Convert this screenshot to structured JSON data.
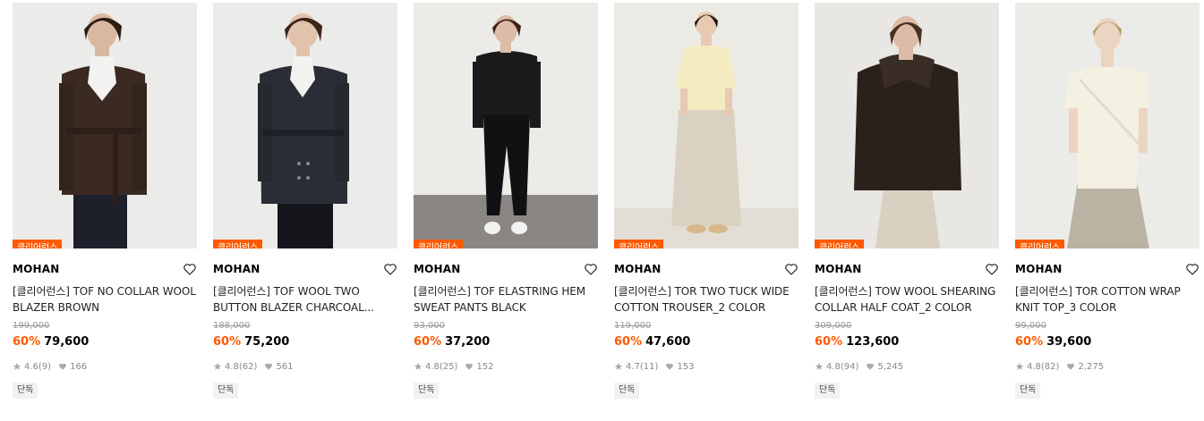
{
  "colors": {
    "accent": "#ff5a00",
    "strike": "#999999",
    "meta": "#888888"
  },
  "products": [
    {
      "tag": "클리어런스",
      "brand": "MOHAN",
      "name": "[클리어런스] TOF NO COLLAR WOOL BLAZER BROWN",
      "original_price": "199,000",
      "discount": "60%",
      "price": "79,600",
      "rating": "4.6",
      "reviews": "(9)",
      "likes": "166",
      "badge": "단독"
    },
    {
      "tag": "클리어런스",
      "brand": "MOHAN",
      "name": "[클리어런스] TOF WOOL TWO BUTTON BLAZER CHARCOAL...",
      "original_price": "188,000",
      "discount": "60%",
      "price": "75,200",
      "rating": "4.8",
      "reviews": "(62)",
      "likes": "561",
      "badge": "단독"
    },
    {
      "tag": "클리어런스",
      "brand": "MOHAN",
      "name": "[클리어런스] TOF ELASTRING HEM SWEAT PANTS BLACK",
      "original_price": "93,000",
      "discount": "60%",
      "price": "37,200",
      "rating": "4.8",
      "reviews": "(25)",
      "likes": "152",
      "badge": "단독"
    },
    {
      "tag": "클리어런스",
      "brand": "MOHAN",
      "name": "[클리어런스] TOR TWO TUCK WIDE COTTON TROUSER_2 COLOR",
      "original_price": "119,000",
      "discount": "60%",
      "price": "47,600",
      "rating": "4.7",
      "reviews": "(11)",
      "likes": "153",
      "badge": "단독"
    },
    {
      "tag": "클리어런스",
      "brand": "MOHAN",
      "name": "[클리어런스] TOW WOOL SHEARING COLLAR HALF COAT_2 COLOR",
      "original_price": "309,000",
      "discount": "60%",
      "price": "123,600",
      "rating": "4.8",
      "reviews": "(94)",
      "likes": "5,245",
      "badge": "단독"
    },
    {
      "tag": "클리어런스",
      "brand": "MOHAN",
      "name": "[클리어런스] TOR COTTON WRAP KNIT TOP_3 COLOR",
      "original_price": "99,000",
      "discount": "60%",
      "price": "39,600",
      "rating": "4.8",
      "reviews": "(82)",
      "likes": "2,275",
      "badge": "단독"
    }
  ]
}
